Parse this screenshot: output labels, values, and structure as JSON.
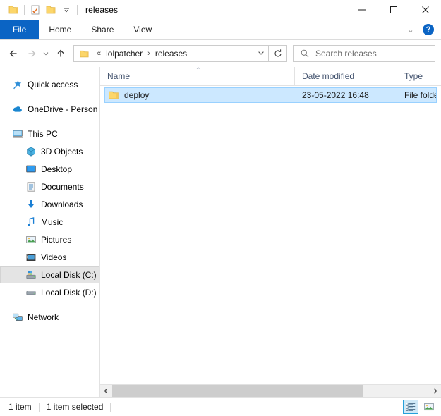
{
  "window": {
    "title": "releases",
    "quick_access": [
      {
        "name": "folder-icon",
        "label": "Folder"
      },
      {
        "name": "properties-icon",
        "label": "Properties"
      },
      {
        "name": "new-folder-icon",
        "label": "New folder"
      }
    ],
    "qat_dropdown": "−",
    "controls": {
      "minimize": "─",
      "maximize": "☐",
      "close": "✕"
    }
  },
  "ribbon": {
    "tabs": [
      {
        "label": "File",
        "active": true
      },
      {
        "label": "Home",
        "active": false
      },
      {
        "label": "Share",
        "active": false
      },
      {
        "label": "View",
        "active": false
      }
    ],
    "expand_chevron": "⌄",
    "help_label": "?"
  },
  "nav": {
    "back_label": "←",
    "forward_label": "→",
    "history_label": "⌄",
    "up_label": "↑",
    "refresh_label": "↻",
    "address": {
      "prefix": "«",
      "crumbs": [
        "lolpatcher",
        "releases"
      ],
      "separator": "›",
      "dropdown": "⌄"
    }
  },
  "search": {
    "placeholder": "Search releases",
    "value": ""
  },
  "sidebar": {
    "items": [
      {
        "label": "Quick access",
        "icon": "star-pin-icon",
        "level": 0,
        "selected": false,
        "gap_after": true
      },
      {
        "label": "OneDrive - Person",
        "icon": "cloud-icon",
        "level": 0,
        "selected": false,
        "gap_after": true
      },
      {
        "label": "This PC",
        "icon": "computer-icon",
        "level": 0,
        "selected": false,
        "gap_after": false
      },
      {
        "label": "3D Objects",
        "icon": "3d-objects-icon",
        "level": 1,
        "selected": false,
        "gap_after": false
      },
      {
        "label": "Desktop",
        "icon": "desktop-icon",
        "level": 1,
        "selected": false,
        "gap_after": false
      },
      {
        "label": "Documents",
        "icon": "documents-icon",
        "level": 1,
        "selected": false,
        "gap_after": false
      },
      {
        "label": "Downloads",
        "icon": "downloads-icon",
        "level": 1,
        "selected": false,
        "gap_after": false
      },
      {
        "label": "Music",
        "icon": "music-icon",
        "level": 1,
        "selected": false,
        "gap_after": false
      },
      {
        "label": "Pictures",
        "icon": "pictures-icon",
        "level": 1,
        "selected": false,
        "gap_after": false
      },
      {
        "label": "Videos",
        "icon": "videos-icon",
        "level": 1,
        "selected": false,
        "gap_after": false
      },
      {
        "label": "Local Disk (C:)",
        "icon": "system-drive-icon",
        "level": 1,
        "selected": true,
        "gap_after": false
      },
      {
        "label": "Local Disk (D:)",
        "icon": "drive-icon",
        "level": 1,
        "selected": false,
        "gap_after": true
      },
      {
        "label": "Network",
        "icon": "network-icon",
        "level": 0,
        "selected": false,
        "gap_after": false
      }
    ]
  },
  "filelist": {
    "columns": [
      {
        "label": "Name",
        "sorted": true,
        "sort_caret": "⌃"
      },
      {
        "label": "Date modified",
        "sorted": false
      },
      {
        "label": "Type",
        "sorted": false
      }
    ],
    "rows": [
      {
        "name": "deploy",
        "date_modified": "23-05-2022 16:48",
        "type": "File folder",
        "icon": "folder-icon",
        "selected": true
      }
    ]
  },
  "scrollbar": {
    "left_arrow": "‹",
    "right_arrow": "›"
  },
  "statusbar": {
    "item_count": "1 item",
    "selection_count": "1 item selected",
    "views": [
      {
        "name": "details-view",
        "active": true
      },
      {
        "name": "large-icons-view",
        "active": false
      }
    ]
  },
  "colors": {
    "accent": "#0b64c4",
    "selection": "#cce8ff",
    "selection_border": "#99d1ff",
    "folder": "#fcd66a",
    "header_text": "#44546f"
  }
}
